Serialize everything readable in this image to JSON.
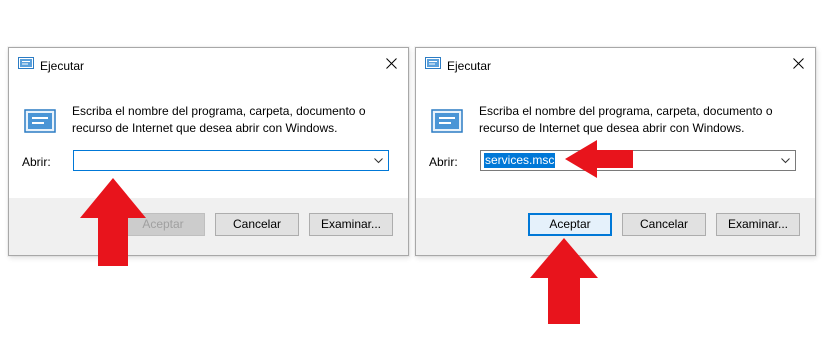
{
  "dialogs": [
    {
      "title": "Ejecutar",
      "description": "Escriba el nombre del programa, carpeta, documento o recurso de Internet que desea abrir con Windows.",
      "open_label": "Abrir:",
      "input_value": "",
      "buttons": {
        "accept": "Aceptar",
        "cancel": "Cancelar",
        "browse": "Examinar..."
      },
      "accept_enabled": false
    },
    {
      "title": "Ejecutar",
      "description": "Escriba el nombre del programa, carpeta, documento o recurso de Internet que desea abrir con Windows.",
      "open_label": "Abrir:",
      "input_value": "services.msc",
      "buttons": {
        "accept": "Aceptar",
        "cancel": "Cancelar",
        "browse": "Examinar..."
      },
      "accept_enabled": true
    }
  ],
  "colors": {
    "annotation_arrow": "#e8141c",
    "accent": "#0078d7"
  },
  "icons": [
    "run-icon",
    "close-icon",
    "chevron-down-icon"
  ]
}
